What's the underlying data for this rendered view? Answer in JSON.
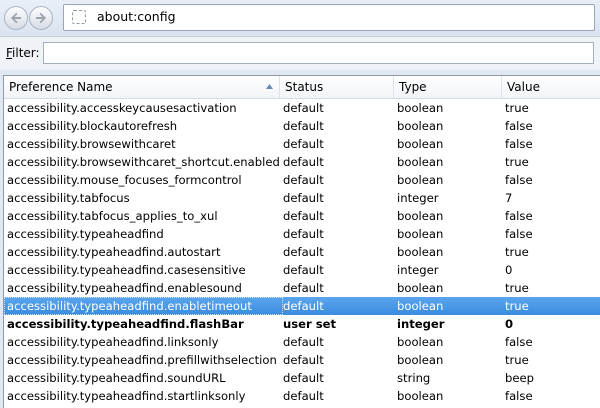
{
  "navbar": {
    "back_icon": "back-arrow-icon",
    "forward_icon": "forward-arrow-icon",
    "url": "about:config"
  },
  "filter": {
    "label_underlined": "F",
    "label_rest": "ilter:",
    "value": ""
  },
  "table": {
    "headers": {
      "name": "Preference Name",
      "status": "Status",
      "type": "Type",
      "value": "Value"
    },
    "rows": [
      {
        "name": "accessibility.accesskeycausesactivation",
        "status": "default",
        "type": "boolean",
        "value": "true"
      },
      {
        "name": "accessibility.blockautorefresh",
        "status": "default",
        "type": "boolean",
        "value": "false"
      },
      {
        "name": "accessibility.browsewithcaret",
        "status": "default",
        "type": "boolean",
        "value": "false"
      },
      {
        "name": "accessibility.browsewithcaret_shortcut.enabled",
        "status": "default",
        "type": "boolean",
        "value": "true"
      },
      {
        "name": "accessibility.mouse_focuses_formcontrol",
        "status": "default",
        "type": "boolean",
        "value": "false"
      },
      {
        "name": "accessibility.tabfocus",
        "status": "default",
        "type": "integer",
        "value": "7"
      },
      {
        "name": "accessibility.tabfocus_applies_to_xul",
        "status": "default",
        "type": "boolean",
        "value": "false"
      },
      {
        "name": "accessibility.typeaheadfind",
        "status": "default",
        "type": "boolean",
        "value": "false"
      },
      {
        "name": "accessibility.typeaheadfind.autostart",
        "status": "default",
        "type": "boolean",
        "value": "true"
      },
      {
        "name": "accessibility.typeaheadfind.casesensitive",
        "status": "default",
        "type": "integer",
        "value": "0"
      },
      {
        "name": "accessibility.typeaheadfind.enablesound",
        "status": "default",
        "type": "boolean",
        "value": "true"
      },
      {
        "name": "accessibility.typeaheadfind.enabletimeout",
        "status": "default",
        "type": "boolean",
        "value": "true",
        "selected": true
      },
      {
        "name": "accessibility.typeaheadfind.flashBar",
        "status": "user set",
        "type": "integer",
        "value": "0",
        "modified": true
      },
      {
        "name": "accessibility.typeaheadfind.linksonly",
        "status": "default",
        "type": "boolean",
        "value": "false"
      },
      {
        "name": "accessibility.typeaheadfind.prefillwithselection",
        "status": "default",
        "type": "boolean",
        "value": "true"
      },
      {
        "name": "accessibility.typeaheadfind.soundURL",
        "status": "default",
        "type": "string",
        "value": "beep"
      },
      {
        "name": "accessibility.typeaheadfind.startlinksonly",
        "status": "default",
        "type": "boolean",
        "value": "false"
      }
    ]
  },
  "colors": {
    "selection": "#3a8ce0",
    "chrome": "#dfe8f3"
  }
}
